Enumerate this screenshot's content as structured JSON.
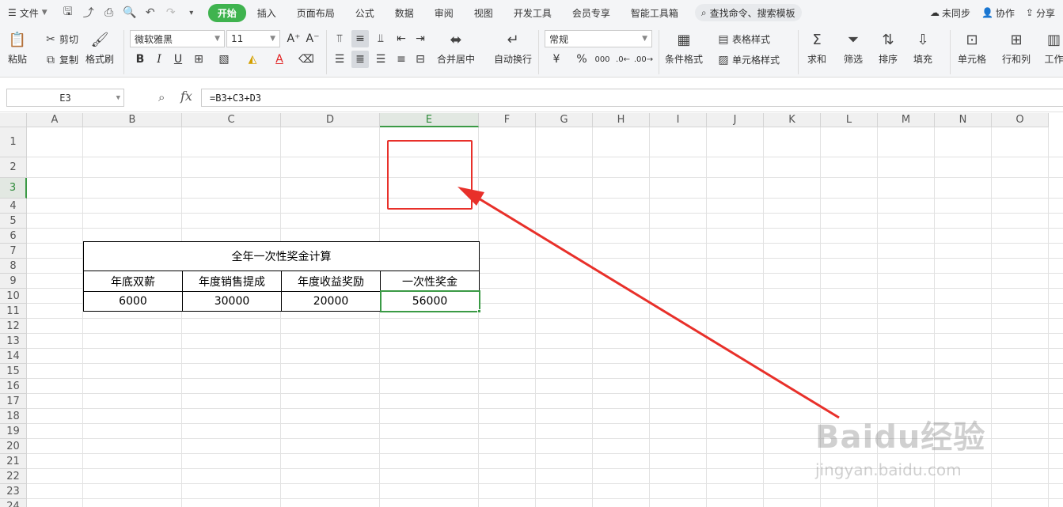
{
  "menu": {
    "file_label": "文件",
    "tabs": [
      "开始",
      "插入",
      "页面布局",
      "公式",
      "数据",
      "审阅",
      "视图",
      "开发工具",
      "会员专享",
      "智能工具箱"
    ],
    "search_label": "查找命令、搜索模板",
    "sync_label": "未同步",
    "collab_label": "协作",
    "share_label": "分享"
  },
  "ribbon": {
    "paste": "粘贴",
    "cut": "剪切",
    "copy": "复制",
    "format_painter": "格式刷",
    "font_name": "微软雅黑",
    "font_size": "11",
    "merge_center": "合并居中",
    "wrap_text": "自动换行",
    "number_format": "常规",
    "cond_format": "条件格式",
    "table_style": "表格样式",
    "cell_style": "单元格样式",
    "sum": "求和",
    "filter": "筛选",
    "sort": "排序",
    "fill": "填充",
    "cell": "单元格",
    "row_col": "行和列",
    "worksheet": "工作"
  },
  "formula_bar": {
    "name_box": "E3",
    "fx": "fx",
    "formula": "=B3+C3+D3"
  },
  "sheet": {
    "columns": [
      "A",
      "B",
      "C",
      "D",
      "E",
      "F",
      "G",
      "H",
      "I",
      "J",
      "K",
      "L",
      "M",
      "N",
      "O"
    ],
    "rows": [
      "1",
      "2",
      "3",
      "4",
      "5",
      "6",
      "7",
      "8",
      "9",
      "10",
      "11",
      "12",
      "13",
      "14",
      "15",
      "16",
      "17",
      "18",
      "19",
      "20",
      "21",
      "22",
      "23",
      "24"
    ],
    "selected_col": "E",
    "selected_row": "3",
    "title": "全年一次性奖金计算",
    "headers": [
      "年底双薪",
      "年度销售提成",
      "年度收益奖励",
      "一次性奖金"
    ],
    "values": [
      "6000",
      "30000",
      "20000",
      "56000"
    ]
  },
  "watermark": {
    "brand": "Baidu经验",
    "url": "jingyan.baidu.com"
  },
  "colors": {
    "accent": "#3fb34f",
    "selection": "#3a9a45",
    "annotation": "#e8302a"
  }
}
